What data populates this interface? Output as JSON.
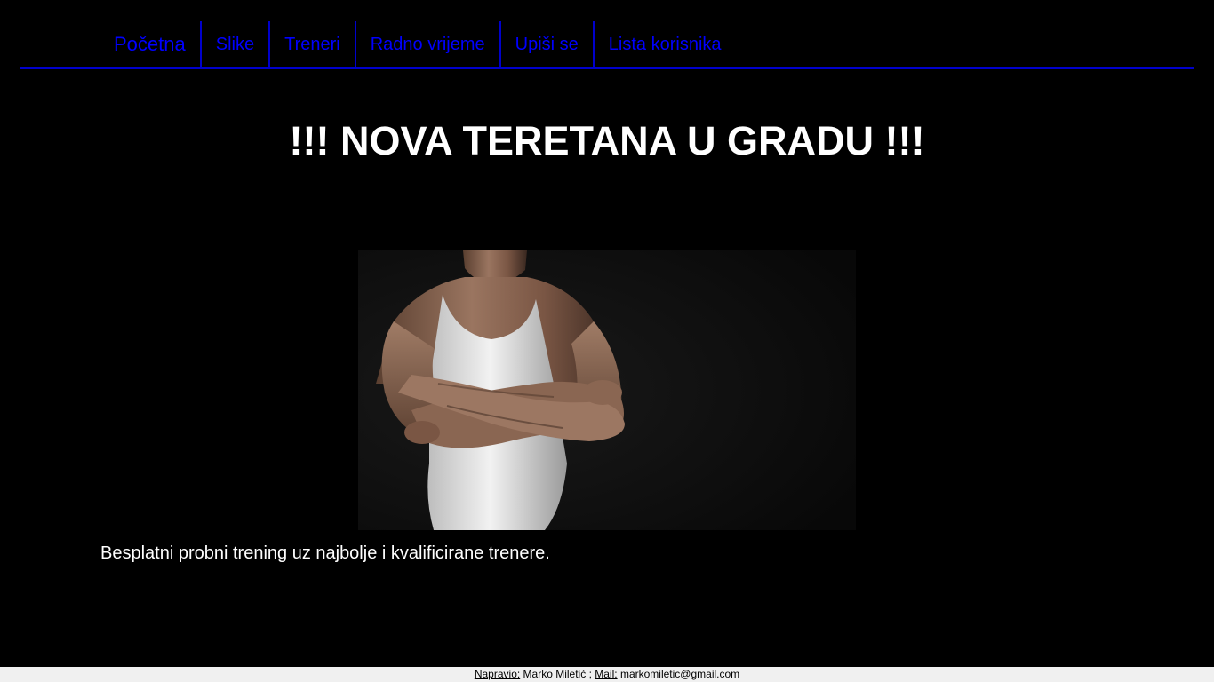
{
  "nav": {
    "items": [
      {
        "label": "Početna"
      },
      {
        "label": "Slike"
      },
      {
        "label": "Treneri"
      },
      {
        "label": "Radno vrijeme"
      },
      {
        "label": "Upiši se"
      },
      {
        "label": "Lista korisnika"
      }
    ]
  },
  "main": {
    "headline": "!!! NOVA TERETANA U GRADU !!!",
    "tagline": "Besplatni probni trening uz najbolje i kvalificirane trenere."
  },
  "footer": {
    "author_label": "Napravio:",
    "author_name": "Marko Miletić",
    "separator": ";",
    "mail_label": "Mail:",
    "mail_value": "markomiletic@gmail.com"
  },
  "colors": {
    "background": "#000000",
    "nav_link": "#0000ff",
    "nav_border": "#0000cc",
    "text": "#ffffff",
    "footer_bg": "#f0f0f0"
  }
}
